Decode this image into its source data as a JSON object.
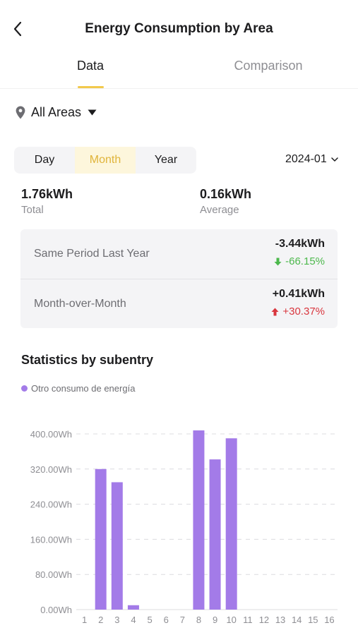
{
  "header": {
    "title": "Energy Consumption by Area"
  },
  "tabs": [
    {
      "label": "Data",
      "active": true
    },
    {
      "label": "Comparison",
      "active": false
    }
  ],
  "area_filter": {
    "label": "All Areas"
  },
  "period_selector": {
    "options": [
      "Day",
      "Month",
      "Year"
    ],
    "selected": "Month"
  },
  "date_picker": {
    "value": "2024-01"
  },
  "summary": {
    "total_value": "1.76kWh",
    "total_label": "Total",
    "average_value": "0.16kWh",
    "average_label": "Average"
  },
  "comparison": {
    "rows": [
      {
        "label": "Same Period Last Year",
        "amount": "-3.44kWh",
        "percent": "-66.15%",
        "direction": "down"
      },
      {
        "label": "Month-over-Month",
        "amount": "+0.41kWh",
        "percent": "+30.37%",
        "direction": "up"
      }
    ]
  },
  "statistics": {
    "title": "Statistics by subentry"
  },
  "colors": {
    "accent": "#f2c94c",
    "bar": "#a37be8",
    "down": "#4cb84c",
    "up": "#d9363e"
  },
  "chart_data": {
    "type": "bar",
    "categories": [
      "1",
      "2",
      "3",
      "4",
      "5",
      "6",
      "7",
      "8",
      "9",
      "10",
      "11",
      "12",
      "13",
      "14",
      "15",
      "16"
    ],
    "series": [
      {
        "name": "Otro consumo de energía",
        "values": [
          0,
          320,
          290,
          10,
          0,
          0,
          0,
          408,
          342,
          390,
          0,
          0,
          0,
          0,
          0,
          0
        ]
      }
    ],
    "yticks": [
      "0.00Wh",
      "80.00Wh",
      "160.00Wh",
      "240.00Wh",
      "320.00Wh",
      "400.00Wh"
    ],
    "ylim": [
      0,
      400
    ],
    "grid": true,
    "legend": "top-left"
  }
}
